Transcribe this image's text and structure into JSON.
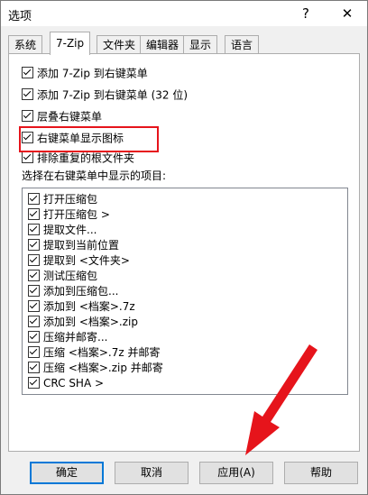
{
  "window": {
    "title": "选项",
    "help_glyph": "?",
    "close_glyph": "✕"
  },
  "tabs": [
    "系统",
    "7-Zip",
    "文件夹",
    "编辑器",
    "显示",
    "语言"
  ],
  "options": [
    "添加 7-Zip 到右键菜单",
    "添加 7-Zip 到右键菜单 (32 位)",
    "层叠右键菜单",
    "右键菜单显示图标",
    "排除重复的根文件夹"
  ],
  "list_label": "选择在右键菜单中显示的项目:",
  "list_items": [
    "打开压缩包",
    "打开压缩包 >",
    "提取文件...",
    "提取到当前位置",
    "提取到 <文件夹>",
    "测试压缩包",
    "添加到压缩包...",
    "添加到 <档案>.7z",
    "添加到 <档案>.zip",
    "压缩并邮寄...",
    "压缩 <档案>.7z 并邮寄",
    "压缩 <档案>.zip 并邮寄",
    "CRC SHA >"
  ],
  "buttons": {
    "ok": "确定",
    "cancel": "取消",
    "apply": "应用(A)",
    "help": "帮助"
  },
  "accent_color": "#0078d7",
  "highlight_color": "#e6141b",
  "icons": {
    "checkbox": "checkmark-icon",
    "annotation": "red-arrow-icon"
  }
}
